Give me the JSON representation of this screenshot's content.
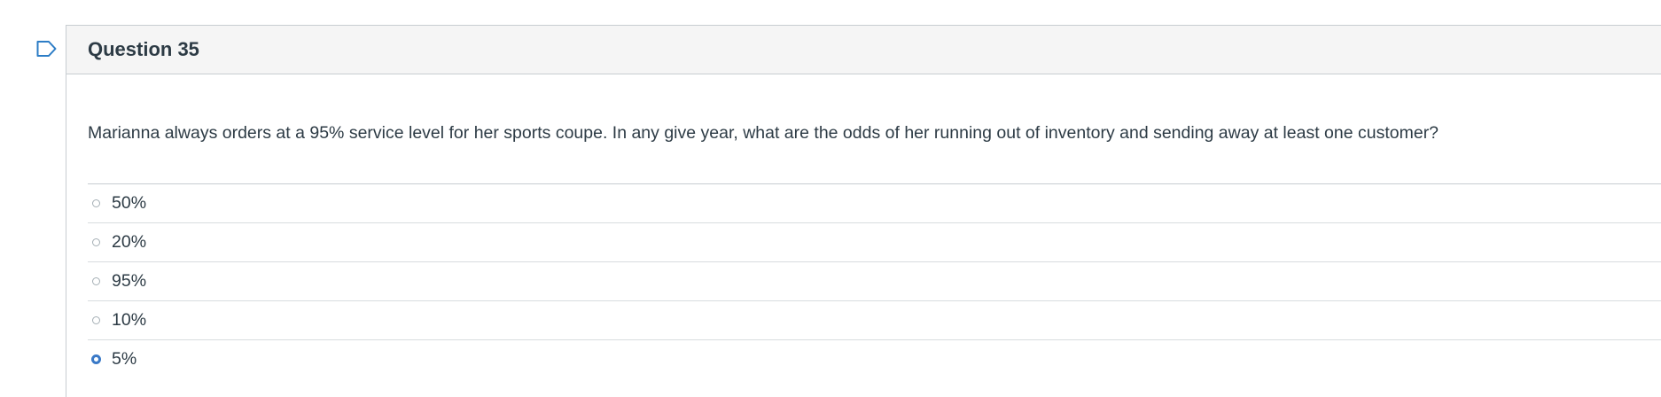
{
  "question": {
    "title": "Question 35",
    "text": "Marianna always orders at a 95% service level for her sports coupe. In any give year, what are the odds of her running out of inventory and sending away at least one customer?",
    "answers": [
      {
        "label": "50%",
        "selected": false
      },
      {
        "label": "20%",
        "selected": false
      },
      {
        "label": "95%",
        "selected": false
      },
      {
        "label": "10%",
        "selected": false
      },
      {
        "label": "5%",
        "selected": true
      }
    ]
  },
  "icons": {
    "flag": "flag-outline-icon"
  },
  "colors": {
    "header_bg": "#f5f5f5",
    "border": "#c7cdd1",
    "text": "#2d3b45",
    "selected_radio": "#3a79c7"
  }
}
